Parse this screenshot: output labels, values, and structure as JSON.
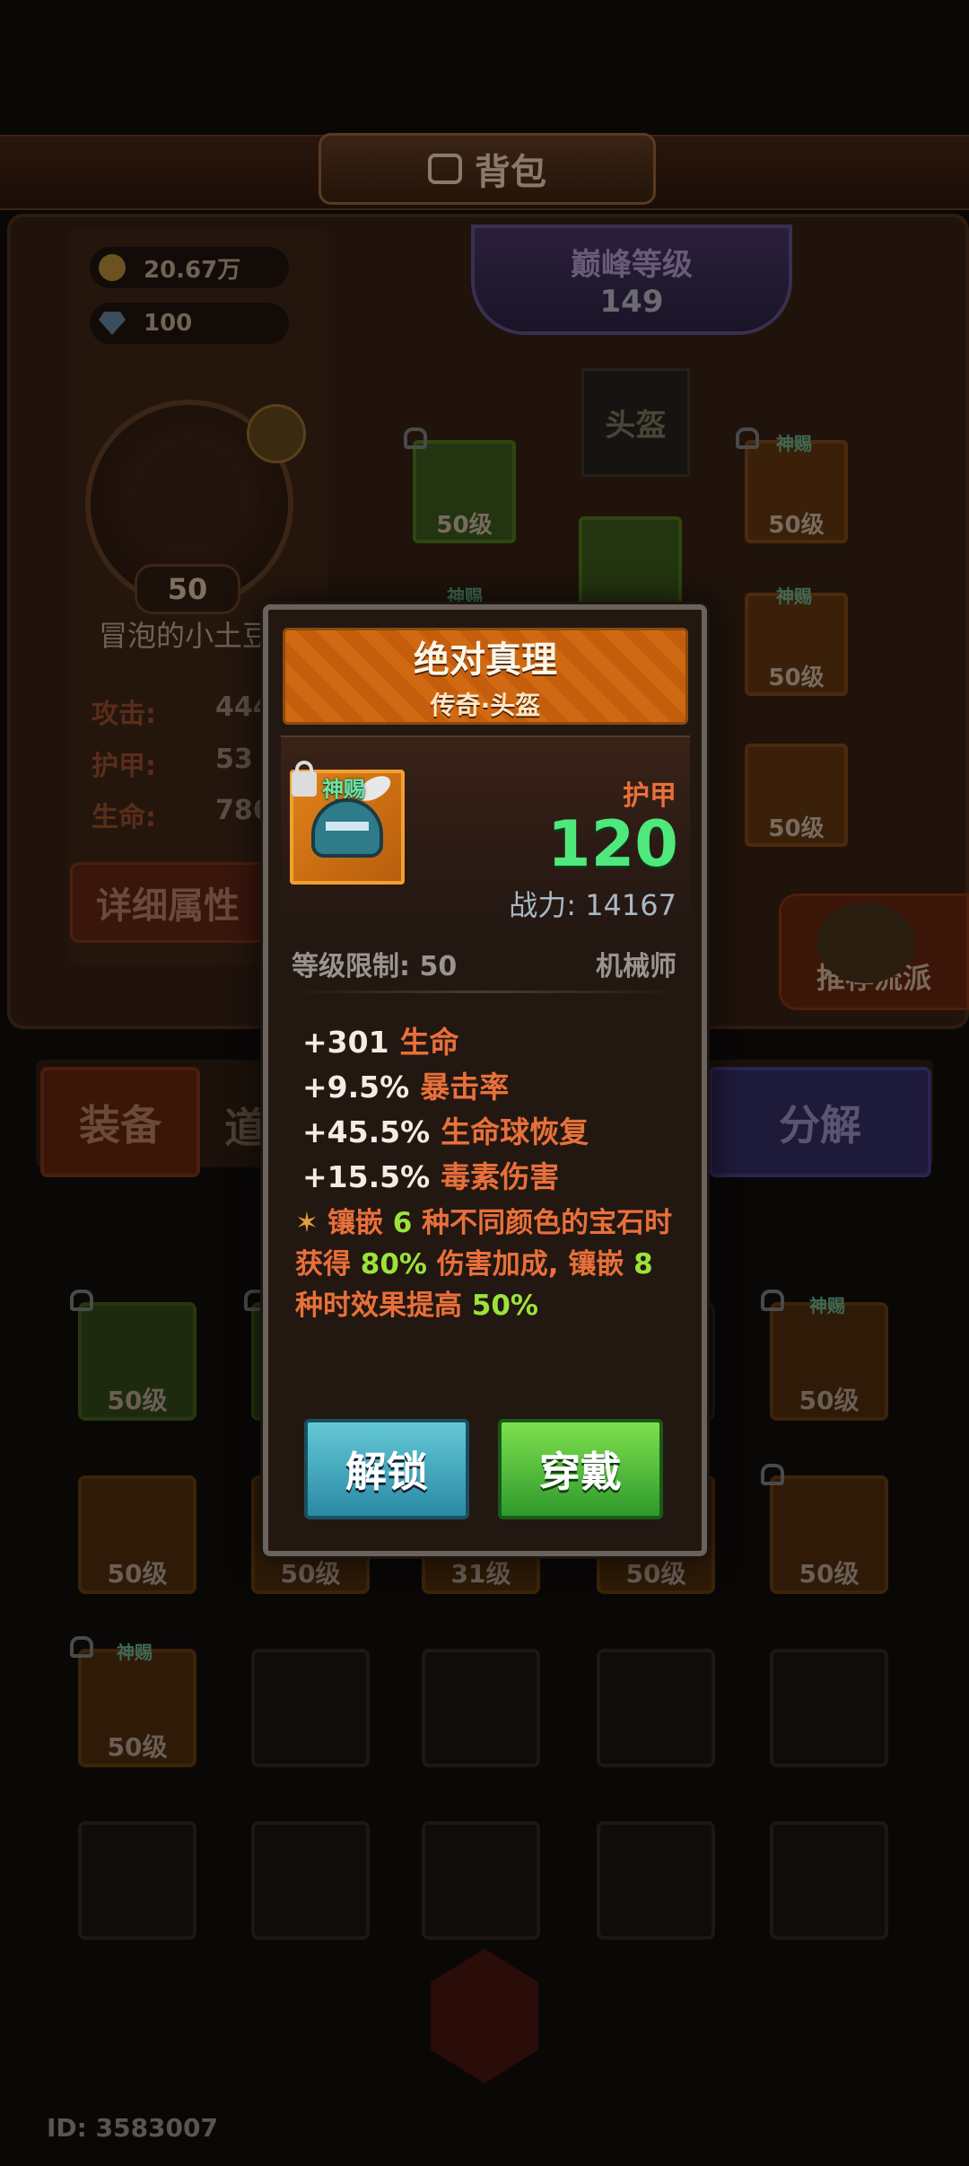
{
  "header": {
    "title": "背包"
  },
  "resources": {
    "gold": "20.67万",
    "gems": "100"
  },
  "player": {
    "level": "50",
    "name": "冒泡的小土豆",
    "stats": [
      {
        "label": "攻击:",
        "value": "444"
      },
      {
        "label": "护甲:",
        "value": "53"
      },
      {
        "label": "生命:",
        "value": "786"
      }
    ],
    "detail_button": "详细属性"
  },
  "peak": {
    "title": "巅峰等级",
    "level": "149"
  },
  "equipment_slots": {
    "helmet_placeholder": "头盔",
    "items": [
      {
        "level": "50级",
        "tag": "",
        "color": "green"
      },
      {
        "level": "50级",
        "tag": "神赐",
        "color": "orange"
      },
      {
        "level": "50级",
        "tag": "神赐",
        "color": "orange"
      },
      {
        "level": "50级",
        "tag": "",
        "color": "orange"
      },
      {
        "level": "",
        "tag": "神赐",
        "color": "green"
      }
    ]
  },
  "recommend_button": "推荐流派",
  "tabs": {
    "equip": "装备",
    "item": "道",
    "decompose": "分解"
  },
  "inventory": {
    "row1": [
      {
        "level": "50级",
        "tag": "",
        "color": "green"
      },
      {
        "level": "",
        "tag": "",
        "color": "green"
      },
      {
        "level": "",
        "tag": "",
        "color": "empty"
      },
      {
        "level": "",
        "tag": "",
        "color": "empty"
      },
      {
        "level": "50级",
        "tag": "神赐",
        "color": "orange"
      }
    ],
    "row2": [
      {
        "level": "50级",
        "tag": "",
        "color": "orange"
      },
      {
        "level": "50级",
        "tag": "",
        "color": "orange"
      },
      {
        "level": "31级",
        "tag": "",
        "color": "orange"
      },
      {
        "level": "50级",
        "tag": "",
        "color": "orange"
      },
      {
        "level": "50级",
        "tag": "",
        "color": "orange"
      }
    ],
    "row3": [
      {
        "level": "50级",
        "tag": "神赐",
        "color": "orange"
      }
    ]
  },
  "player_id": "ID: 3583007",
  "modal": {
    "item_name": "绝对真理",
    "item_type": "传奇·头盔",
    "divine_tag": "神赐",
    "stat_type": "护甲",
    "stat_value": "120",
    "power": "战力: 14167",
    "level_requirement": "等级限制: 50",
    "class": "机械师",
    "attributes": [
      {
        "value": "+301",
        "name": "生命"
      },
      {
        "value": "+9.5%",
        "name": "暴击率"
      },
      {
        "value": "+45.5%",
        "name": "生命球恢复"
      },
      {
        "value": "+15.5%",
        "name": "毒素伤害"
      }
    ],
    "bonus": {
      "part1": "镶嵌",
      "n1": "6",
      "part2": "种不同颜色的宝石时获得",
      "pct1": "80%",
      "part3": "伤害加成, 镶嵌",
      "n2": "8",
      "part4": "种时效果提高",
      "pct2": "50%"
    },
    "unlock_button": "解锁",
    "wear_button": "穿戴"
  },
  "colors": {
    "header_orange": "#d06a12",
    "stat_green": "#4fe87c",
    "label_orange": "#e8703a",
    "highlight_green": "#9be33b",
    "divine_green": "#6ee4a4"
  }
}
